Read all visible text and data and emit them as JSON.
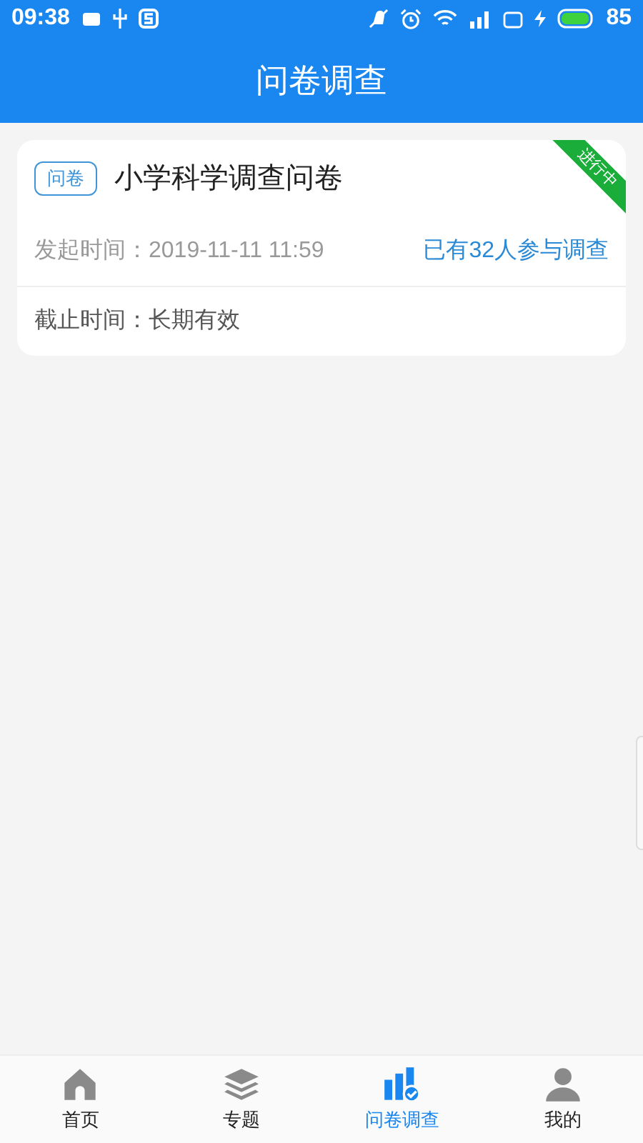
{
  "status_bar": {
    "time": "09:38",
    "battery": "85"
  },
  "header": {
    "title": "问卷调查"
  },
  "surveys": [
    {
      "tag": "问卷",
      "title": "小学科学调查问卷",
      "status": "进行中",
      "start_label": "发起时间：",
      "start_time": "2019-11-11 11:59",
      "participants": "已有32人参与调查",
      "end_label": "截止时间：",
      "end_time": "长期有效"
    }
  ],
  "tab_bar": [
    {
      "label": "首页",
      "selected": false
    },
    {
      "label": "专题",
      "selected": false
    },
    {
      "label": "问卷调查",
      "selected": true
    },
    {
      "label": "我的",
      "selected": false
    }
  ]
}
